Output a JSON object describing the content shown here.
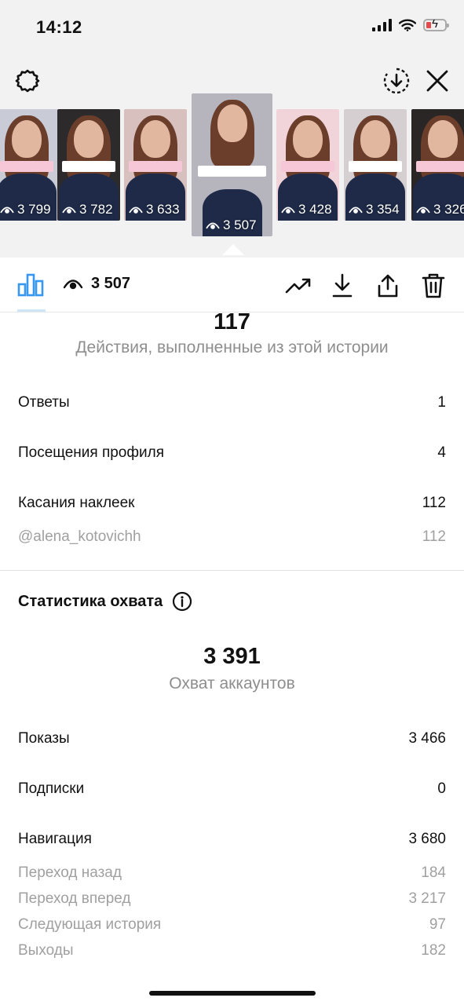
{
  "status_bar": {
    "time": "14:12"
  },
  "stories": [
    {
      "views": "3 799",
      "bg": "#c9cbd6"
    },
    {
      "views": "3 782",
      "bg": "#2d2a2b"
    },
    {
      "views": "3 633",
      "bg": "#d8c0bf"
    },
    {
      "views": "3 507",
      "bg": "#b6b4bd",
      "selected": true
    },
    {
      "views": "3 428",
      "bg": "#f1d3da"
    },
    {
      "views": "3 354",
      "bg": "#d6cfd2"
    },
    {
      "views": "3 326",
      "bg": "#2b2626"
    }
  ],
  "toolbar": {
    "views": "3 507"
  },
  "interactions": {
    "total": "117",
    "caption": "Действия, выполненные из этой истории",
    "rows": [
      {
        "label": "Ответы",
        "value": "1"
      },
      {
        "label": "Посещения профиля",
        "value": "4"
      },
      {
        "label": "Касания наклеек",
        "value": "112"
      }
    ],
    "sub_rows": [
      {
        "label": "@alena_kotovichh",
        "value": "112"
      }
    ]
  },
  "reach": {
    "title": "Статистика охвата",
    "total": "3 391",
    "caption": "Охват аккаунтов",
    "rows": [
      {
        "label": "Показы",
        "value": "3 466"
      },
      {
        "label": "Подписки",
        "value": "0"
      },
      {
        "label": "Навигация",
        "value": "3 680"
      }
    ],
    "sub_rows": [
      {
        "label": "Переход назад",
        "value": "184"
      },
      {
        "label": "Переход вперед",
        "value": "3 217"
      },
      {
        "label": "Следующая история",
        "value": "97"
      },
      {
        "label": "Выходы",
        "value": "182"
      }
    ]
  },
  "colors": {
    "accent": "#3897f0",
    "top_bg": "#f2f2f2",
    "muted": "#8e8e8e"
  }
}
